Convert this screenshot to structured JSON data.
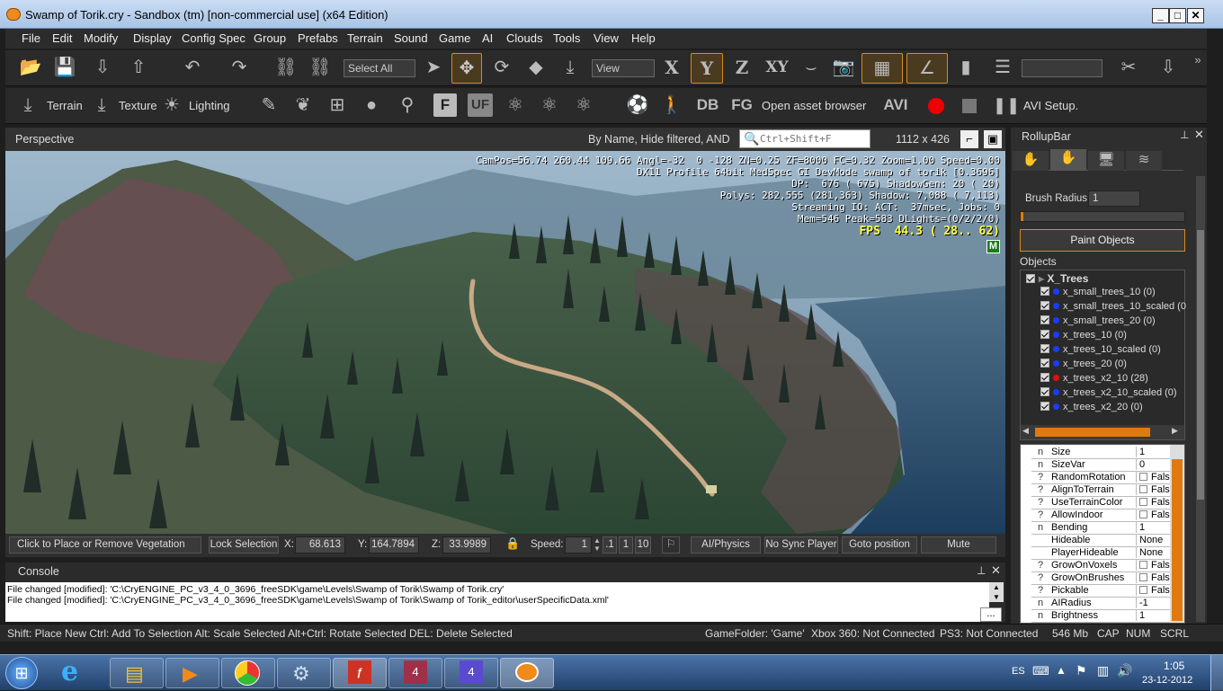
{
  "window": {
    "title": "Swamp of Torik.cry - Sandbox (tm) [non-commercial use] (x64 Edition)"
  },
  "menu": [
    "File",
    "Edit",
    "Modify",
    "Display",
    "Config Spec",
    "Group",
    "Prefabs",
    "Terrain",
    "Sound",
    "Game",
    "AI",
    "Clouds",
    "Tools",
    "View",
    "Help"
  ],
  "toolbar1": {
    "select_all": "Select All",
    "view": "View",
    "axis_x": "X",
    "axis_y": "Y",
    "axis_z": "Z",
    "axis_xy": "XY"
  },
  "toolbar2": {
    "terrain": "Terrain",
    "texture": "Texture",
    "lighting": "Lighting",
    "f": "F",
    "uf": "UF",
    "db": "DB",
    "fg": "FG",
    "asset_browser": "Open asset browser",
    "avi": "AVI",
    "avi_setup": "AVI Setup."
  },
  "viewport": {
    "title": "Perspective",
    "filter": "By Name, Hide filtered, AND",
    "search_placeholder": "Ctrl+Shift+F",
    "size": "1112 x 426",
    "stats": [
      "CamPos=56.74 260.44 109.66 Angl=-32  0 -128 ZN=0.25 ZF=8000 FC=0.32 Zoom=1.00 Speed=0.00",
      "DX11 Profile 64bit MedSpec GI DevMode swamp of torik [0.3696]",
      "DP:  676 ( 675) ShadowGen: 20 ( 20)",
      "Polys: 282,555 (281,363) Shadow: 7,088 ( 7,113)",
      "Streaming IO: ACT:  37msec, Jobs: 0",
      "Mem=546 Peak=583 DLights=(0/2/2/0)"
    ],
    "fps": "FPS  44.3 ( 28.. 62)",
    "badge": "M"
  },
  "status": {
    "hint": "Click to Place or Remove Vegetation",
    "lock": "Lock Selection",
    "x_label": "X:",
    "x": "68.613",
    "y_label": "Y:",
    "y": "164.7894",
    "z_label": "Z:",
    "z": "33.9989",
    "speed_label": "Speed:",
    "speed": "1",
    "s1": ".1",
    "s2": "1",
    "s3": "10",
    "ai_physics": "AI/Physics",
    "no_sync": "No Sync Player",
    "goto": "Goto position",
    "mute": "Mute"
  },
  "console": {
    "title": "Console",
    "lines": [
      "File changed [modified]: 'C:\\CryENGINE_PC_v3_4_0_3696_freeSDK\\game\\Levels\\Swamp of Torik\\Swamp of Torik.cry'",
      "File changed [modified]: 'C:\\CryENGINE_PC_v3_4_0_3696_freeSDK\\game\\Levels\\Swamp of Torik\\Swamp of Torik_editor\\userSpecificData.xml'"
    ],
    "more": "..."
  },
  "hints": {
    "keys": "Shift: Place New  Ctrl: Add To Selection  Alt: Scale Selected  Alt+Ctrl: Rotate Selected DEL: Delete Selected",
    "game_folder": "GameFolder: 'Game'",
    "xbox": "Xbox 360: Not Connected",
    "ps3": "PS3: Not Connected",
    "mem": "546 Mb",
    "cap": "CAP",
    "num": "NUM",
    "scrl": "SCRL"
  },
  "rollup": {
    "title": "RollupBar",
    "brush_label": "Brush Radius:",
    "brush": "1",
    "paint": "Paint Objects",
    "objects_label": "Objects",
    "root": "X_Trees",
    "items": [
      {
        "label": "x_small_trees_10 (0)",
        "color": "#1a3cff"
      },
      {
        "label": "x_small_trees_10_scaled (0",
        "color": "#1a3cff"
      },
      {
        "label": "x_small_trees_20 (0)",
        "color": "#1a3cff"
      },
      {
        "label": "x_trees_10 (0)",
        "color": "#1a3cff"
      },
      {
        "label": "x_trees_10_scaled (0)",
        "color": "#1a3cff"
      },
      {
        "label": "x_trees_20 (0)",
        "color": "#1a3cff"
      },
      {
        "label": "x_trees_x2_10 (28)",
        "color": "#e01010"
      },
      {
        "label": "x_trees_x2_10_scaled (0)",
        "color": "#1a3cff"
      },
      {
        "label": "x_trees_x2_20 (0)",
        "color": "#1a3cff"
      }
    ],
    "props": [
      {
        "t": "n",
        "name": "Size",
        "value": "1"
      },
      {
        "t": "n",
        "name": "SizeVar",
        "value": "0"
      },
      {
        "t": "?",
        "name": "RandomRotation",
        "value": "False",
        "cb": true
      },
      {
        "t": "?",
        "name": "AlignToTerrain",
        "value": "False",
        "cb": true
      },
      {
        "t": "?",
        "name": "UseTerrainColor",
        "value": "False",
        "cb": true
      },
      {
        "t": "?",
        "name": "AllowIndoor",
        "value": "False",
        "cb": true
      },
      {
        "t": "n",
        "name": "Bending",
        "value": "1"
      },
      {
        "t": "",
        "name": "Hideable",
        "value": "None"
      },
      {
        "t": "",
        "name": "PlayerHideable",
        "value": "None"
      },
      {
        "t": "?",
        "name": "GrowOnVoxels",
        "value": "False",
        "cb": true
      },
      {
        "t": "?",
        "name": "GrowOnBrushes",
        "value": "False",
        "cb": true
      },
      {
        "t": "?",
        "name": "Pickable",
        "value": "False",
        "cb": true
      },
      {
        "t": "n",
        "name": "AIRadius",
        "value": "-1"
      },
      {
        "t": "n",
        "name": "Brightness",
        "value": "1"
      }
    ]
  },
  "tray": {
    "lang": "ES",
    "time": "1:05",
    "date": "23-12-2012"
  }
}
